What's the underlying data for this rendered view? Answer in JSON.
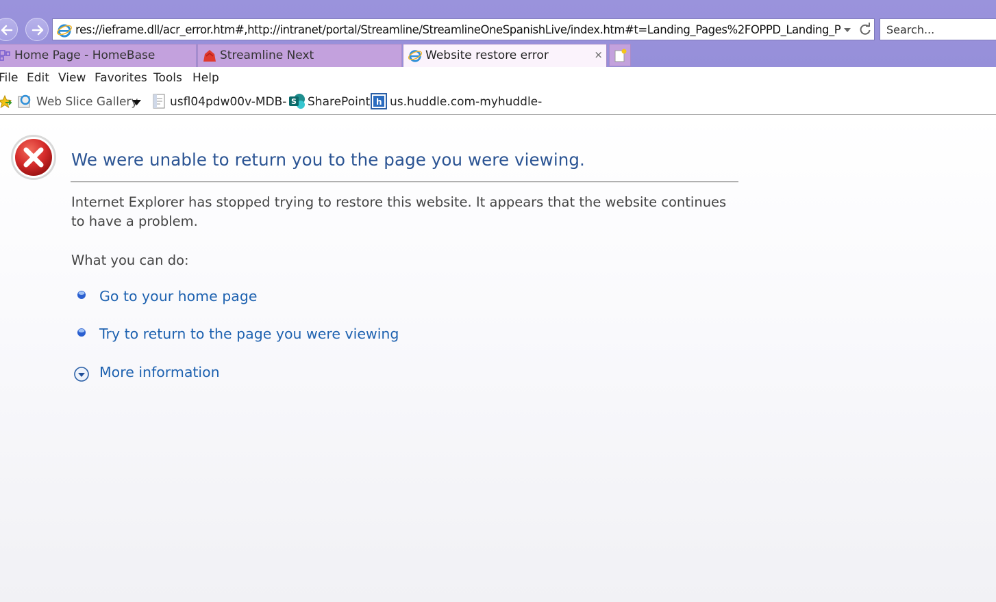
{
  "browser": {
    "address": "res://ieframe.dll/acr_error.htm#,http://intranet/portal/Streamline/StreamlineOneSpanishLive/index.htm#t=Landing_Pages%2FOPPD_Landing_P",
    "search_placeholder": "Search..."
  },
  "tabs": [
    {
      "label": "Home Page - HomeBase",
      "active": false
    },
    {
      "label": "Streamline Next",
      "active": false
    },
    {
      "label": "Website restore error",
      "active": true
    }
  ],
  "tab_close_glyph": "×",
  "menu": [
    "File",
    "Edit",
    "View",
    "Favorites",
    "Tools",
    "Help"
  ],
  "favorites": [
    {
      "label": "Web Slice Gallery",
      "icon": "web-slice-icon"
    },
    {
      "label": "usfl04pdw00v-MDB-",
      "icon": "page-icon"
    },
    {
      "label": "SharePoint",
      "icon": "sharepoint-icon"
    },
    {
      "label": "us.huddle.com-myhuddle-",
      "icon": "huddle-icon"
    }
  ],
  "content": {
    "title": "We were unable to return you to the page you were viewing.",
    "description": "Internet Explorer has stopped trying to restore this website. It appears that the website continues to have a problem.",
    "what_heading": "What you can do:",
    "actions": [
      {
        "label": "Go to your home page"
      },
      {
        "label": "Try to return to the page you were viewing"
      },
      {
        "label": "More information"
      }
    ]
  },
  "colors": {
    "title_blue": "#2b5493",
    "link_blue": "#1e62b0",
    "titlebar": "#9a93dc",
    "tab": "#c3a1dd",
    "error_red": "#d42a2a"
  }
}
